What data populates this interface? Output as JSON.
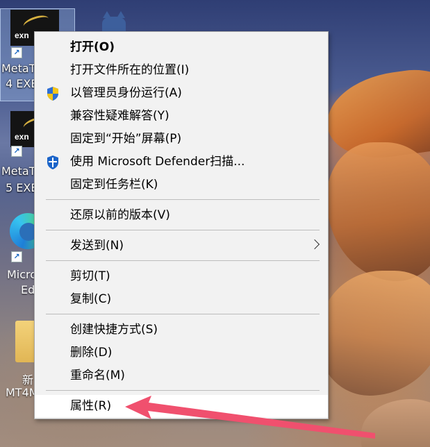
{
  "desktop": {
    "icons": [
      {
        "label_lines": [
          "MetaT",
          "4 EXE"
        ],
        "thumb_text": "exn"
      },
      {
        "label_lines": [
          "MetaT",
          "5 EXE"
        ],
        "thumb_text": "exn"
      },
      {
        "label_lines": [
          "Micro",
          "Ed"
        ]
      },
      {
        "label_lines": [
          "新",
          "MT4M"
        ]
      }
    ]
  },
  "context_menu": {
    "items": {
      "open": "打开(O)",
      "open_location": "打开文件所在的位置(I)",
      "run_as_admin": "以管理员身份运行(A)",
      "compat": "兼容性疑难解答(Y)",
      "pin_start": "固定到“开始”屏幕(P)",
      "defender": "使用 Microsoft Defender扫描...",
      "pin_taskbar": "固定到任务栏(K)",
      "restore": "还原以前的版本(V)",
      "send_to": "发送到(N)",
      "cut": "剪切(T)",
      "copy": "复制(C)",
      "create_shortcut": "创建快捷方式(S)",
      "delete": "删除(D)",
      "rename": "重命名(M)",
      "properties": "属性(R)"
    },
    "highlighted": "properties"
  },
  "colors": {
    "menu_bg": "#f2f2f2",
    "menu_highlight": "#ffffff",
    "annotation_arrow": "#f0506e",
    "shield_blue": "#2f6fd6",
    "shield_yellow": "#f5c518"
  },
  "icons": {
    "run_as_admin": "uac-shield-icon",
    "defender": "defender-shield-icon",
    "send_to": "chevron-right-icon"
  }
}
